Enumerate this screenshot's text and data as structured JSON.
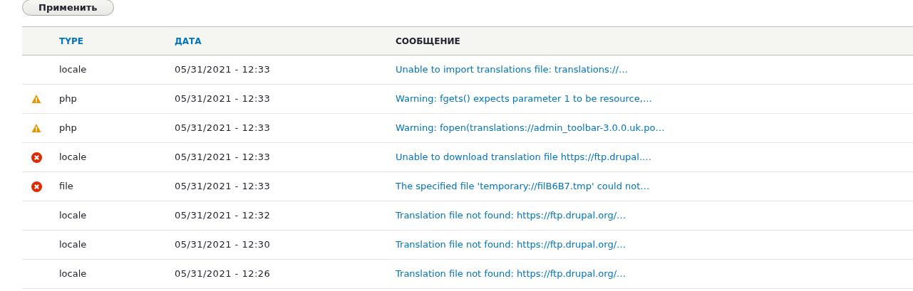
{
  "apply_button": "Применить",
  "table": {
    "columns": [
      {
        "label": "TYPE",
        "sortable": true
      },
      {
        "label": "ДАТА",
        "sortable": true
      },
      {
        "label": "СООБЩЕНИЕ",
        "sortable": false
      }
    ],
    "rows": [
      {
        "kind": "none",
        "type": "locale",
        "date": "05/31/2021 - 12:33",
        "message": "Unable to import translations file: translations://…"
      },
      {
        "kind": "warning",
        "type": "php",
        "date": "05/31/2021 - 12:33",
        "message": "Warning: fgets() expects parameter 1 to be resource,…"
      },
      {
        "kind": "warning",
        "type": "php",
        "date": "05/31/2021 - 12:33",
        "message": "Warning: fopen(translations://admin_toolbar-3.0.0.uk.po…"
      },
      {
        "kind": "error",
        "type": "locale",
        "date": "05/31/2021 - 12:33",
        "message": "Unable to download translation file https://ftp.drupal.…"
      },
      {
        "kind": "error",
        "type": "file",
        "date": "05/31/2021 - 12:33",
        "message": "The specified file 'temporary://filB6B7.tmp' could not…"
      },
      {
        "kind": "none",
        "type": "locale",
        "date": "05/31/2021 - 12:32",
        "message": "Translation file not found: https://ftp.drupal.org/…"
      },
      {
        "kind": "none",
        "type": "locale",
        "date": "05/31/2021 - 12:30",
        "message": "Translation file not found: https://ftp.drupal.org/…"
      },
      {
        "kind": "none",
        "type": "locale",
        "date": "05/31/2021 - 12:26",
        "message": "Translation file not found: https://ftp.drupal.org/…"
      }
    ]
  }
}
